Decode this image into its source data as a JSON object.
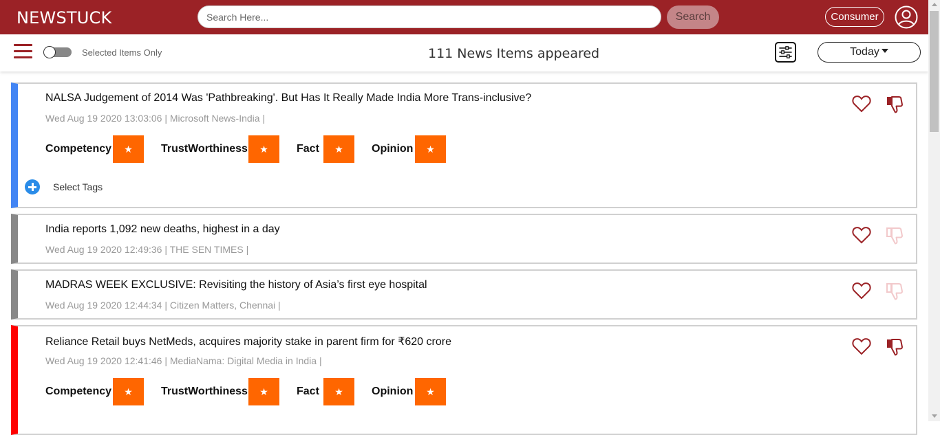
{
  "header": {
    "brand": "NEWSTUCK",
    "search_placeholder": "Search Here...",
    "search_button": "Search",
    "role_button": "Consumer"
  },
  "toolbar": {
    "toggle_label": "Selected Items Only",
    "count_label": "111 News Items appeared",
    "period_button": "Today"
  },
  "colors": {
    "brand": "#9b2226",
    "rating_star": "#ff6600",
    "stripe_blue": "#4285f4",
    "stripe_gray": "#888888",
    "stripe_red": "#ff0000"
  },
  "ratings_labels": [
    "Competency",
    "TrustWorthiness",
    "Fact",
    "Opinion"
  ],
  "tags_label": "Select Tags",
  "news": [
    {
      "title": "NALSA Judgement of 2014 Was 'Pathbreaking'. But Has It Really Made India More Trans-inclusive?",
      "meta": "Wed Aug 19 2020 13:03:06  | Microsoft News-India |",
      "stripe": "blue",
      "disliked": true
    },
    {
      "title": "India reports 1,092 new deaths, highest in a day",
      "meta": "Wed Aug 19 2020 12:49:36  | THE SEN TIMES |",
      "stripe": "gray",
      "disliked": false
    },
    {
      "title": "MADRAS WEEK EXCLUSIVE: Revisiting the history of Asia’s first eye hospital",
      "meta": "Wed Aug 19 2020 12:44:34  | Citizen Matters, Chennai |",
      "stripe": "gray",
      "disliked": false
    },
    {
      "title": "Reliance Retail buys NetMeds, acquires majority stake in parent firm for ₹620 crore",
      "meta": "Wed Aug 19 2020 12:41:46  | MediaNama: Digital Media in India |",
      "stripe": "red",
      "disliked": true
    }
  ],
  "rating_star_symbol": "★"
}
